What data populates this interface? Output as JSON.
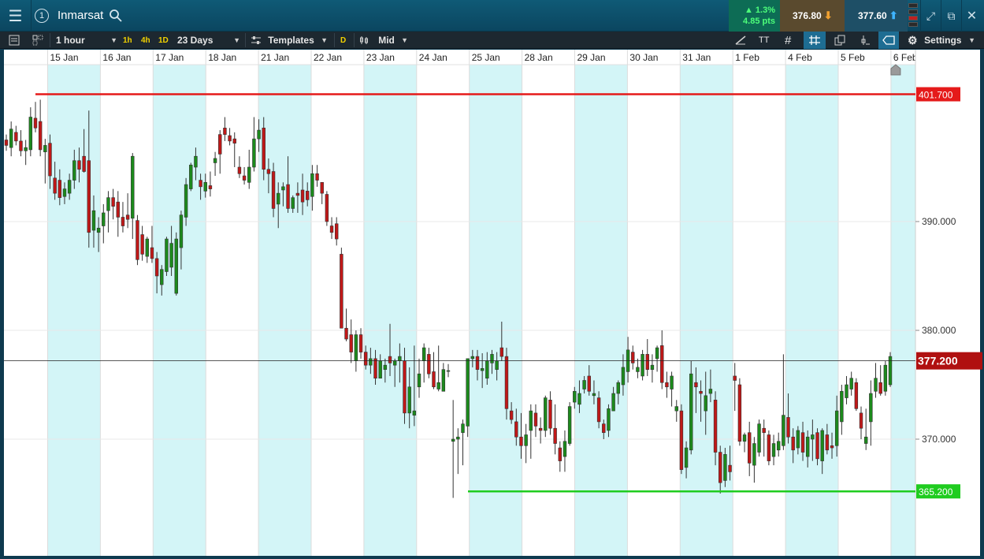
{
  "header": {
    "instrument": "Inmarsat",
    "change_pct": "▲ 1.3%",
    "change_pts": "4.85 pts",
    "sell_price": "376.80",
    "buy_price": "377.60",
    "icons": [
      "menu-icon",
      "info-icon",
      "search-icon",
      "expand-icon",
      "popout-icon",
      "close-icon"
    ]
  },
  "toolbar": {
    "interval": "1 hour",
    "quick_intervals": [
      "1h",
      "4h",
      "1D"
    ],
    "range": "23 Days",
    "templates": "Templates",
    "d_label": "D",
    "price_type": "Mid",
    "settings": "Settings"
  },
  "chart_data": {
    "type": "candlestick",
    "instrument": "Inmarsat",
    "x_labels": [
      "15 Jan",
      "16 Jan",
      "17 Jan",
      "18 Jan",
      "21 Jan",
      "22 Jan",
      "23 Jan",
      "24 Jan",
      "25 Jan",
      "28 Jan",
      "29 Jan",
      "30 Jan",
      "31 Jan",
      "1 Feb",
      "4 Feb",
      "5 Feb",
      "6 Feb"
    ],
    "y_ticks": [
      "370.000",
      "380.000",
      "390.000"
    ],
    "ylim": [
      354.3,
      404.6
    ],
    "resistance": {
      "label": "401.700",
      "value": 401.7,
      "color": "#e51a1a"
    },
    "support": {
      "label": "365.200",
      "value": 365.2,
      "color": "#1fcc1f"
    },
    "last_price": {
      "label": "377.200",
      "value": 377.2,
      "color": "#b01010"
    },
    "up_color": "#1c8a1c",
    "down_color": "#c01818",
    "band_color": "#d3f5f7",
    "candles": [
      [
        397.5,
        398.0,
        396.5,
        397.0
      ],
      [
        396.8,
        399.2,
        396.0,
        398.5
      ],
      [
        398.2,
        398.8,
        397.0,
        397.4
      ],
      [
        397.4,
        398.4,
        396.0,
        396.5
      ],
      [
        396.5,
        397.5,
        395.2,
        396.8
      ],
      [
        396.6,
        400.5,
        396.0,
        399.6
      ],
      [
        399.5,
        401.0,
        398.2,
        398.6
      ],
      [
        399.2,
        401.2,
        396.0,
        396.6
      ],
      [
        396.4,
        397.6,
        393.5,
        397.0
      ],
      [
        397.2,
        398.0,
        393.0,
        394.2
      ],
      [
        394.0,
        395.5,
        392.0,
        392.6
      ],
      [
        393.8,
        394.8,
        391.5,
        392.2
      ],
      [
        392.3,
        393.6,
        391.6,
        393.0
      ],
      [
        392.6,
        394.4,
        392.0,
        393.8
      ],
      [
        393.8,
        396.6,
        393.0,
        395.6
      ],
      [
        395.6,
        396.8,
        393.6,
        394.8
      ],
      [
        396.0,
        398.5,
        394.5,
        394.6
      ],
      [
        395.6,
        400.2,
        387.6,
        389.0
      ],
      [
        389.2,
        392.4,
        387.6,
        391.0
      ],
      [
        389.0,
        390.4,
        387.2,
        389.4
      ],
      [
        389.6,
        391.6,
        388.0,
        390.8
      ],
      [
        391.0,
        392.8,
        389.0,
        392.2
      ],
      [
        392.2,
        393.0,
        390.2,
        391.4
      ],
      [
        391.8,
        392.8,
        388.6,
        390.4
      ],
      [
        390.4,
        391.8,
        389.0,
        389.6
      ],
      [
        390.6,
        392.6,
        389.4,
        390.2
      ],
      [
        390.3,
        396.3,
        388.4,
        396.0
      ],
      [
        390.1,
        390.6,
        386.0,
        386.5
      ],
      [
        388.8,
        389.6,
        386.4,
        387.0
      ],
      [
        386.8,
        388.6,
        386.2,
        388.4
      ],
      [
        387.6,
        389.6,
        386.2,
        386.6
      ],
      [
        386.6,
        387.2,
        383.4,
        385.0
      ],
      [
        384.2,
        386.0,
        383.2,
        385.6
      ],
      [
        385.4,
        388.6,
        385.0,
        388.4
      ],
      [
        385.8,
        389.6,
        385.0,
        388.0
      ],
      [
        383.4,
        389.0,
        383.2,
        388.4
      ],
      [
        387.6,
        391.0,
        385.6,
        390.6
      ],
      [
        390.4,
        394.0,
        389.6,
        393.4
      ],
      [
        393.0,
        395.4,
        392.8,
        395.2
      ],
      [
        395.0,
        396.8,
        393.8,
        396.0
      ],
      [
        393.8,
        394.4,
        392.0,
        393.2
      ],
      [
        392.8,
        394.4,
        392.2,
        393.6
      ],
      [
        393.3,
        394.6,
        392.3,
        393.0
      ],
      [
        395.4,
        396.4,
        394.2,
        395.8
      ],
      [
        398.0,
        398.4,
        394.4,
        396.2
      ],
      [
        398.6,
        399.6,
        397.4,
        398.0
      ],
      [
        397.9,
        398.6,
        397.0,
        397.4
      ],
      [
        397.6,
        398.2,
        395.0,
        397.2
      ],
      [
        395.0,
        396.0,
        394.0,
        394.4
      ],
      [
        394.2,
        395.0,
        393.4,
        393.8
      ],
      [
        393.6,
        396.6,
        393.0,
        395.0
      ],
      [
        395.0,
        399.6,
        394.6,
        397.6
      ],
      [
        397.6,
        399.4,
        396.4,
        398.4
      ],
      [
        398.6,
        399.6,
        393.8,
        394.8
      ],
      [
        394.8,
        395.8,
        392.6,
        394.4
      ],
      [
        394.6,
        395.4,
        390.4,
        391.2
      ],
      [
        391.6,
        393.6,
        389.4,
        392.6
      ],
      [
        392.9,
        393.6,
        391.4,
        393.2
      ],
      [
        393.4,
        396.0,
        390.8,
        391.2
      ],
      [
        391.2,
        392.4,
        390.8,
        392.2
      ],
      [
        392.6,
        393.6,
        390.8,
        392.4
      ],
      [
        392.9,
        394.4,
        390.6,
        391.8
      ],
      [
        392.8,
        393.6,
        391.4,
        392.0
      ],
      [
        392.3,
        395.2,
        391.0,
        394.4
      ],
      [
        394.4,
        395.2,
        393.2,
        393.8
      ],
      [
        393.6,
        393.6,
        391.6,
        392.6
      ],
      [
        392.5,
        392.8,
        389.6,
        390.0
      ],
      [
        389.6,
        390.4,
        388.4,
        389.0
      ],
      [
        389.8,
        390.4,
        387.8,
        388.4
      ],
      [
        387.0,
        387.6,
        380.6,
        380.2
      ],
      [
        380.2,
        382.0,
        379.0,
        379.2
      ],
      [
        379.6,
        381.0,
        377.0,
        378.0
      ],
      [
        377.2,
        380.0,
        376.2,
        379.6
      ],
      [
        379.6,
        380.2,
        377.4,
        378.0
      ],
      [
        378.0,
        378.6,
        376.4,
        376.8
      ],
      [
        376.8,
        378.4,
        376.0,
        377.4
      ],
      [
        377.4,
        378.2,
        375.0,
        375.6
      ],
      [
        375.6,
        377.8,
        375.6,
        377.2
      ],
      [
        376.4,
        377.4,
        375.2,
        376.8
      ],
      [
        377.6,
        380.6,
        375.8,
        377.0
      ],
      [
        376.8,
        377.4,
        374.8,
        377.2
      ],
      [
        377.2,
        378.8,
        375.2,
        377.6
      ],
      [
        377.2,
        378.4,
        371.4,
        372.4
      ],
      [
        372.4,
        376.6,
        371.0,
        374.8
      ],
      [
        372.2,
        378.6,
        371.2,
        372.6
      ],
      [
        374.8,
        377.4,
        373.8,
        376.0
      ],
      [
        377.2,
        378.8,
        375.2,
        378.4
      ],
      [
        377.8,
        378.4,
        375.6,
        376.0
      ],
      [
        376.2,
        378.0,
        374.6,
        374.8
      ],
      [
        374.6,
        378.6,
        374.4,
        375.2
      ],
      [
        374.4,
        377.0,
        374.4,
        376.4
      ],
      [
        376.3,
        376.9,
        375.7,
        376.3
      ],
      [
        369.8,
        373.6,
        364.6,
        370.0
      ],
      [
        370.0,
        371.0,
        366.8,
        370.2
      ],
      [
        370.6,
        371.8,
        367.6,
        371.4
      ],
      [
        371.2,
        377.4,
        370.2,
        377.4
      ],
      [
        377.4,
        378.2,
        376.6,
        377.6
      ],
      [
        377.6,
        378.2,
        375.4,
        376.4
      ],
      [
        376.3,
        377.9,
        374.7,
        376.5
      ],
      [
        375.6,
        378.0,
        375.0,
        377.2
      ],
      [
        377.0,
        378.2,
        376.0,
        377.8
      ],
      [
        376.4,
        378.0,
        375.4,
        377.2
      ],
      [
        378.4,
        380.8,
        377.2,
        377.6
      ],
      [
        377.6,
        378.4,
        371.8,
        372.8
      ],
      [
        372.6,
        373.4,
        371.4,
        371.8
      ],
      [
        371.6,
        372.8,
        369.4,
        370.2
      ],
      [
        370.2,
        372.4,
        368.2,
        369.4
      ],
      [
        369.4,
        371.4,
        367.8,
        370.4
      ],
      [
        370.8,
        373.2,
        368.2,
        372.6
      ],
      [
        372.4,
        373.2,
        370.2,
        371.2
      ],
      [
        371.0,
        372.0,
        369.6,
        370.8
      ],
      [
        370.8,
        374.0,
        370.2,
        373.8
      ],
      [
        373.6,
        374.4,
        370.4,
        371.0
      ],
      [
        371.0,
        373.2,
        368.6,
        369.6
      ],
      [
        369.2,
        369.8,
        367.0,
        368.0
      ],
      [
        368.4,
        370.8,
        367.0,
        369.8
      ],
      [
        369.6,
        373.4,
        369.4,
        373.0
      ],
      [
        373.4,
        374.8,
        372.8,
        374.4
      ],
      [
        373.2,
        375.4,
        372.4,
        374.2
      ],
      [
        374.6,
        375.8,
        374.2,
        375.4
      ],
      [
        375.8,
        376.8,
        374.0,
        374.4
      ],
      [
        374.0,
        375.4,
        373.2,
        374.2
      ],
      [
        373.8,
        374.4,
        371.0,
        371.6
      ],
      [
        371.4,
        371.8,
        370.0,
        370.6
      ],
      [
        370.8,
        373.2,
        370.2,
        372.8
      ],
      [
        372.6,
        374.8,
        372.6,
        374.2
      ],
      [
        374.2,
        375.4,
        373.2,
        375.2
      ],
      [
        375.0,
        377.8,
        374.0,
        376.6
      ],
      [
        376.2,
        379.4,
        375.2,
        378.2
      ],
      [
        378.0,
        378.6,
        376.4,
        377.0
      ],
      [
        376.2,
        377.4,
        375.6,
        376.6
      ],
      [
        375.8,
        378.2,
        375.4,
        377.8
      ],
      [
        377.8,
        379.2,
        375.8,
        376.4
      ],
      [
        376.4,
        377.8,
        375.2,
        376.8
      ],
      [
        377.4,
        378.6,
        376.2,
        378.4
      ],
      [
        378.6,
        380.0,
        374.6,
        375.2
      ],
      [
        375.2,
        376.2,
        373.8,
        374.8
      ],
      [
        374.6,
        376.2,
        373.0,
        375.8
      ],
      [
        372.6,
        373.6,
        371.6,
        373.0
      ],
      [
        372.6,
        373.2,
        366.8,
        367.2
      ],
      [
        367.4,
        369.8,
        366.4,
        369.2
      ],
      [
        369.0,
        377.2,
        368.6,
        376.0
      ],
      [
        375.2,
        376.6,
        372.4,
        374.8
      ],
      [
        374.4,
        375.4,
        371.6,
        374.2
      ],
      [
        372.6,
        376.2,
        370.4,
        374.0
      ],
      [
        374.2,
        376.4,
        373.4,
        374.6
      ],
      [
        373.6,
        374.4,
        367.6,
        368.8
      ],
      [
        368.8,
        369.4,
        365.0,
        366.0
      ],
      [
        366.2,
        369.2,
        365.6,
        368.6
      ],
      [
        367.6,
        369.4,
        366.2,
        367.0
      ],
      [
        375.8,
        377.0,
        372.6,
        375.4
      ],
      [
        375.0,
        375.6,
        369.4,
        369.8
      ],
      [
        369.8,
        370.6,
        368.8,
        370.4
      ],
      [
        370.6,
        371.6,
        366.6,
        367.8
      ],
      [
        367.6,
        370.2,
        366.0,
        369.6
      ],
      [
        368.8,
        371.8,
        368.4,
        371.4
      ],
      [
        371.0,
        371.8,
        368.4,
        370.6
      ],
      [
        370.4,
        370.8,
        367.6,
        368.0
      ],
      [
        368.4,
        370.4,
        367.6,
        369.6
      ],
      [
        369.0,
        370.6,
        368.4,
        369.8
      ],
      [
        369.4,
        377.8,
        369.0,
        372.2
      ],
      [
        372.0,
        374.2,
        369.6,
        370.2
      ],
      [
        370.2,
        371.0,
        367.8,
        369.0
      ],
      [
        369.2,
        371.2,
        368.6,
        370.8
      ],
      [
        370.6,
        371.6,
        368.0,
        368.8
      ],
      [
        368.4,
        370.8,
        367.4,
        370.2
      ],
      [
        370.0,
        371.8,
        368.0,
        370.4
      ],
      [
        370.6,
        371.0,
        367.6,
        368.2
      ],
      [
        368.0,
        371.0,
        366.8,
        370.8
      ],
      [
        370.4,
        371.4,
        368.6,
        369.0
      ],
      [
        369.4,
        370.6,
        368.2,
        369.2
      ],
      [
        369.4,
        374.0,
        368.4,
        372.6
      ],
      [
        371.6,
        375.0,
        370.4,
        374.4
      ],
      [
        373.8,
        375.8,
        373.2,
        375.0
      ],
      [
        374.6,
        376.2,
        374.0,
        375.6
      ],
      [
        375.2,
        375.6,
        372.6,
        372.8
      ],
      [
        372.4,
        373.0,
        370.0,
        371.0
      ],
      [
        369.6,
        372.8,
        369.0,
        370.2
      ],
      [
        371.6,
        375.4,
        369.4,
        374.2
      ],
      [
        374.4,
        377.0,
        373.8,
        375.6
      ],
      [
        375.2,
        376.8,
        374.0,
        374.2
      ],
      [
        374.4,
        377.2,
        374.0,
        376.8
      ],
      [
        375.0,
        378.0,
        374.8,
        377.6
      ]
    ]
  }
}
